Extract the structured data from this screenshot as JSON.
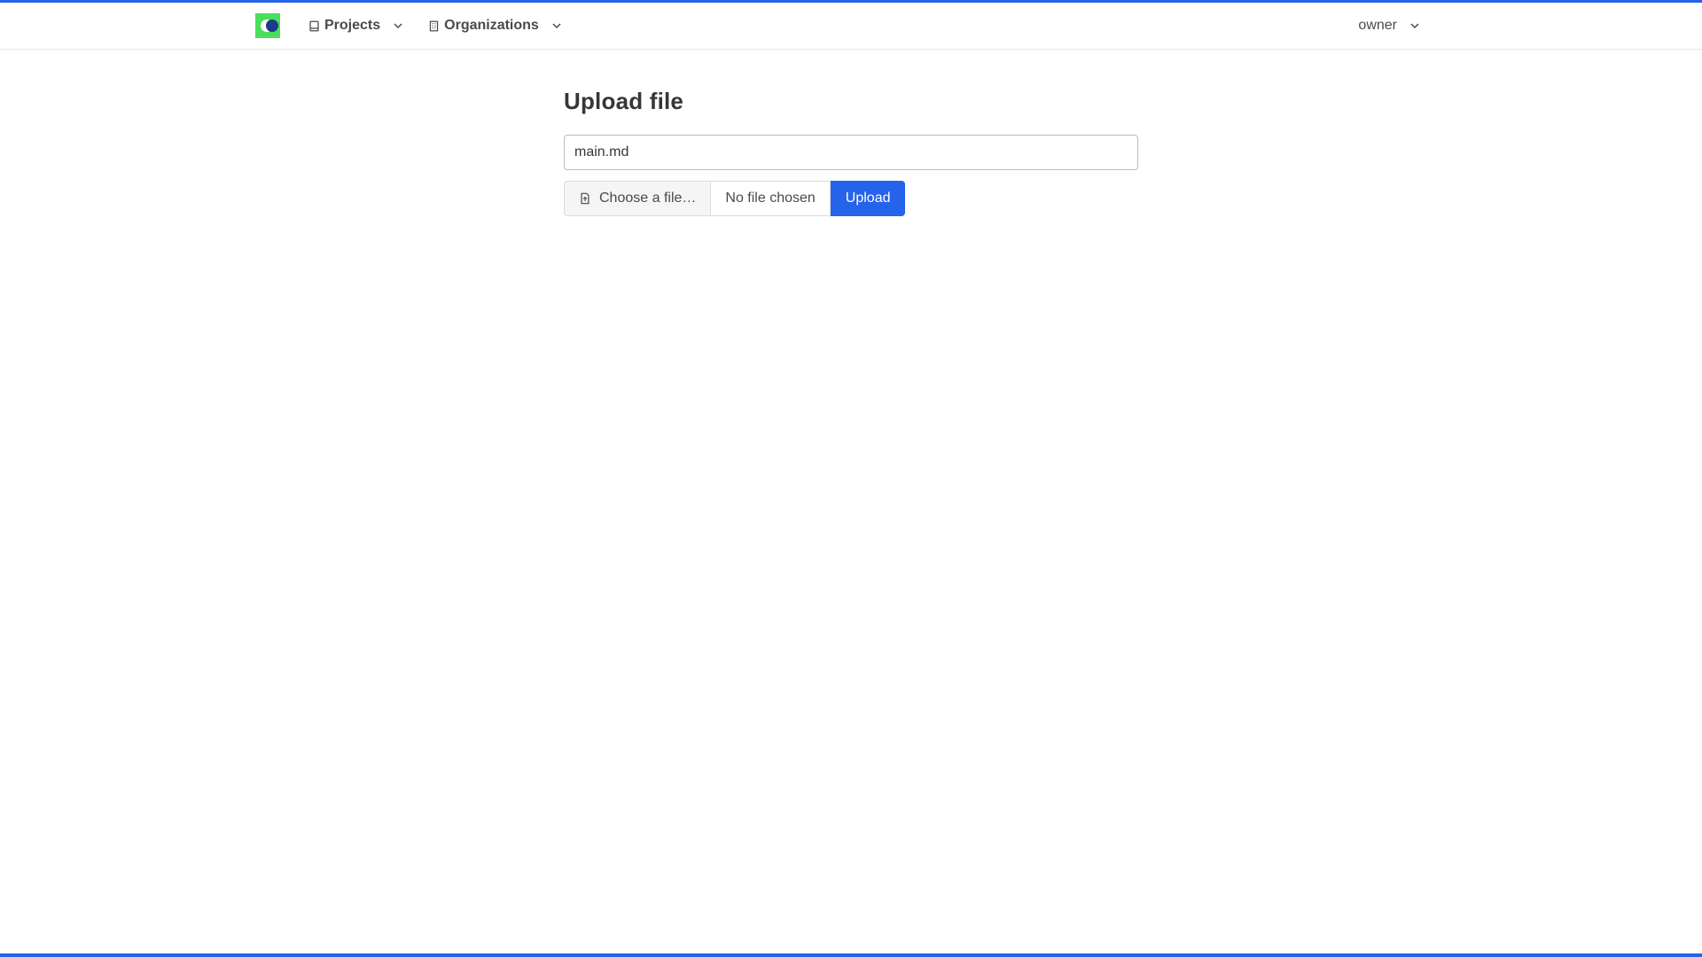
{
  "navbar": {
    "logo_name": "app-logo",
    "items": [
      {
        "label": "Projects",
        "icon": "book-icon"
      },
      {
        "label": "Organizations",
        "icon": "building-icon"
      }
    ],
    "user": {
      "label": "owner"
    }
  },
  "main": {
    "title": "Upload file",
    "filename_value": "main.md",
    "choose_label": "Choose a file…",
    "no_file_label": "No file chosen",
    "upload_label": "Upload"
  },
  "colors": {
    "accent": "#2563eb",
    "logo_bg": "#4ade5a",
    "logo_dot": "#1e3a8a"
  }
}
